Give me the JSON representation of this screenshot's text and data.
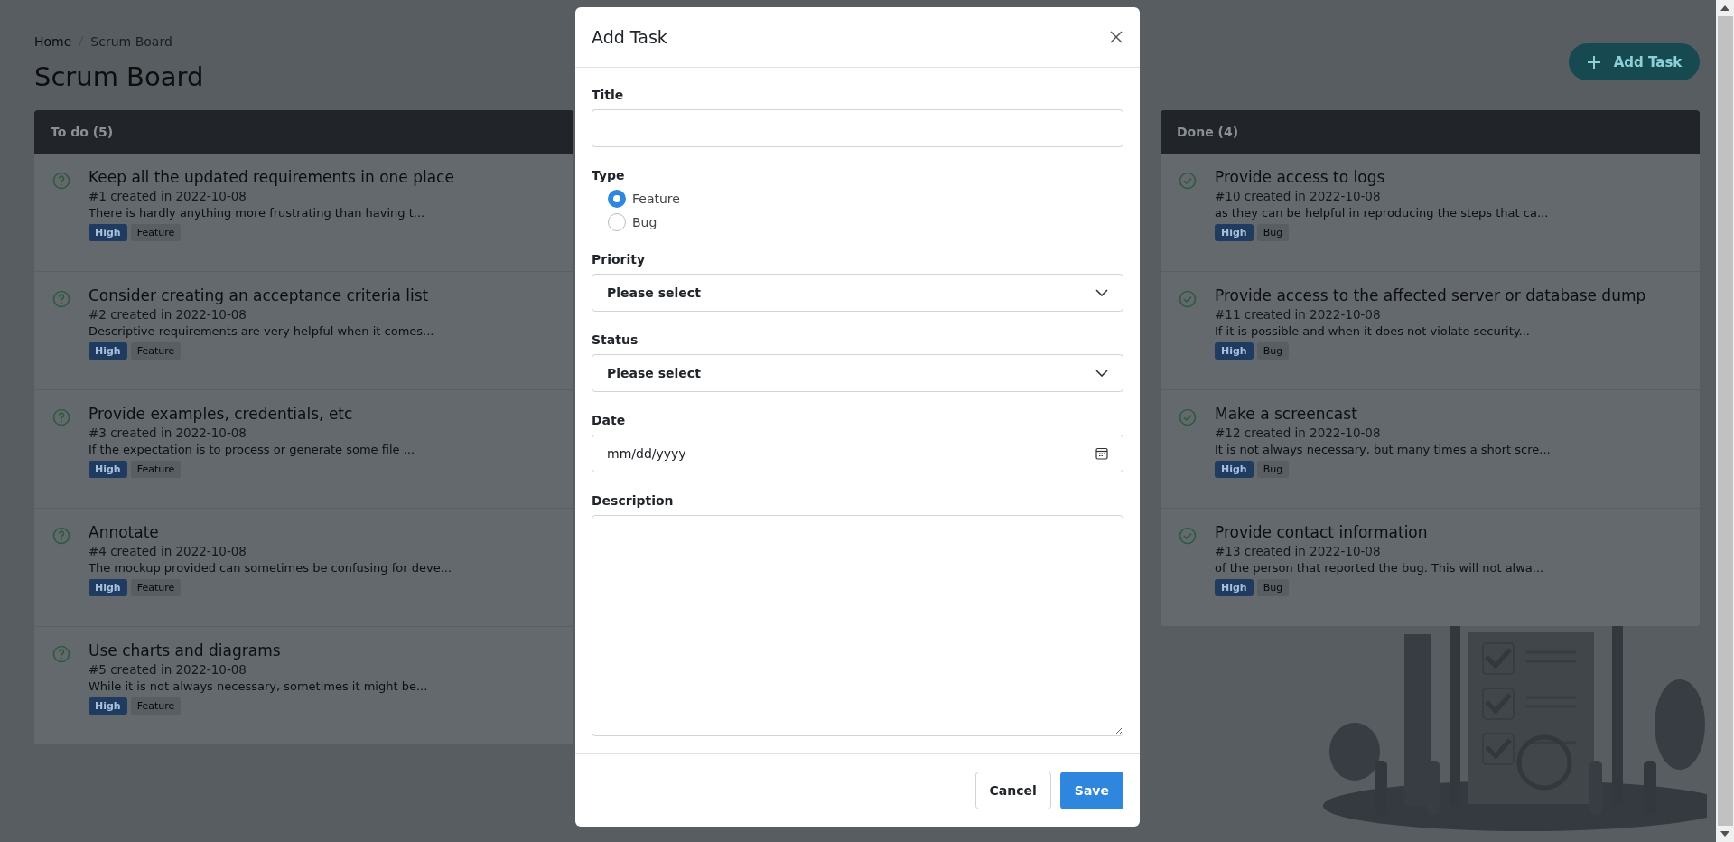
{
  "breadcrumb": [
    {
      "label": "Home"
    },
    {
      "label": "Scrum Board"
    }
  ],
  "page_title": "Scrum Board",
  "add_button": {
    "label": "Add Task"
  },
  "columns": [
    {
      "title": "To do (5)",
      "kind": "todo",
      "tasks": [
        {
          "title": "Keep all the updated requirements in one place",
          "meta": "#1 created in 2022-10-08",
          "description": "There is hardly anything more frustrating than having t...",
          "priority": "High",
          "type": "Feature"
        },
        {
          "title": "Consider creating an acceptance criteria list",
          "meta": "#2 created in 2022-10-08",
          "description": "Descriptive requirements are very helpful when it comes...",
          "priority": "High",
          "type": "Feature"
        },
        {
          "title": "Provide examples, credentials, etc",
          "meta": "#3 created in 2022-10-08",
          "description": "If the expectation is to process or generate some file ...",
          "priority": "High",
          "type": "Feature"
        },
        {
          "title": "Annotate",
          "meta": "#4 created in 2022-10-08",
          "description": "The mockup provided can sometimes be confusing for deve...",
          "priority": "High",
          "type": "Feature"
        },
        {
          "title": "Use charts and diagrams",
          "meta": "#5 created in 2022-10-08",
          "description": "While it is not always necessary, sometimes it might be...",
          "priority": "High",
          "type": "Feature"
        }
      ]
    },
    {
      "title": "Done (4)",
      "kind": "done",
      "tasks": [
        {
          "title": "Provide access to logs",
          "meta": "#10 created in 2022-10-08",
          "description": "as they can be helpful in reproducing the steps that ca...",
          "priority": "High",
          "type": "Bug"
        },
        {
          "title": "Provide access to the affected server or database dump",
          "meta": "#11 created in 2022-10-08",
          "description": "If it is possible and when it does not violate security...",
          "priority": "High",
          "type": "Bug"
        },
        {
          "title": "Make a screencast",
          "meta": "#12 created in 2022-10-08",
          "description": "It is not always necessary, but many times a short scre...",
          "priority": "High",
          "type": "Bug"
        },
        {
          "title": "Provide contact information",
          "meta": "#13 created in 2022-10-08",
          "description": "of the person that reported the bug. This will not alwa...",
          "priority": "High",
          "type": "Bug"
        }
      ]
    }
  ],
  "modal": {
    "title": "Add Task",
    "fields": [
      {
        "kind": "text",
        "label": "Title"
      },
      {
        "kind": "radio",
        "label": "Type",
        "options": [
          {
            "label": "Feature",
            "selected": true
          },
          {
            "label": "Bug",
            "selected": false
          }
        ]
      },
      {
        "kind": "select",
        "label": "Priority",
        "value": "Please select"
      },
      {
        "kind": "select",
        "label": "Status",
        "value": "Please select"
      },
      {
        "kind": "date",
        "label": "Date",
        "value": "mm/dd/yyyy"
      },
      {
        "kind": "textarea",
        "label": "Description"
      }
    ],
    "buttons": [
      {
        "label": "Cancel",
        "kind": "secondary"
      },
      {
        "label": "Save",
        "kind": "primary"
      }
    ]
  }
}
